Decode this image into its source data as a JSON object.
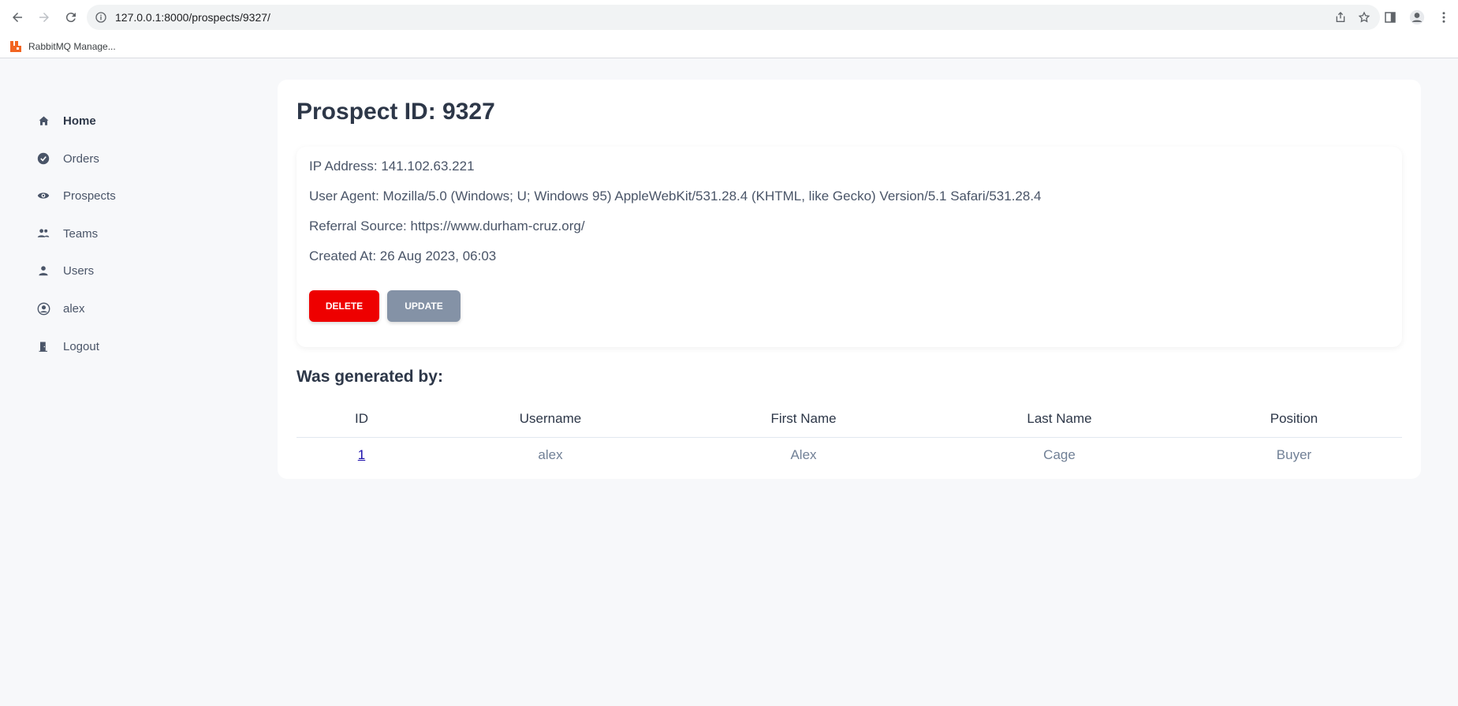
{
  "browser": {
    "url": "127.0.0.1:8000/prospects/9327/",
    "bookmark_label": "RabbitMQ Manage..."
  },
  "sidebar": {
    "items": [
      {
        "label": "Home",
        "icon": "home-icon"
      },
      {
        "label": "Orders",
        "icon": "check-circle-icon"
      },
      {
        "label": "Prospects",
        "icon": "eye-icon"
      },
      {
        "label": "Teams",
        "icon": "users-icon"
      },
      {
        "label": "Users",
        "icon": "user-icon"
      },
      {
        "label": "alex",
        "icon": "user-circle-icon"
      },
      {
        "label": "Logout",
        "icon": "door-icon"
      }
    ]
  },
  "prospect": {
    "title": "Prospect ID: 9327",
    "ip_address": "IP Address: 141.102.63.221",
    "user_agent": "User Agent: Mozilla/5.0 (Windows; U; Windows 95) AppleWebKit/531.28.4 (KHTML, like Gecko) Version/5.1 Safari/531.28.4",
    "referral_source": "Referral Source: https://www.durham-cruz.org/",
    "created_at": "Created At: 26 Aug 2023, 06:03",
    "delete_label": "DELETE",
    "update_label": "UPDATE"
  },
  "generated_by": {
    "title": "Was generated by:",
    "columns": [
      "ID",
      "Username",
      "First Name",
      "Last Name",
      "Position"
    ],
    "rows": [
      [
        "1",
        "alex",
        "Alex",
        "Cage",
        "Buyer"
      ]
    ]
  },
  "colors": {
    "delete": "#ee0000",
    "update": "#8492a6",
    "background": "#f7f8fa"
  }
}
